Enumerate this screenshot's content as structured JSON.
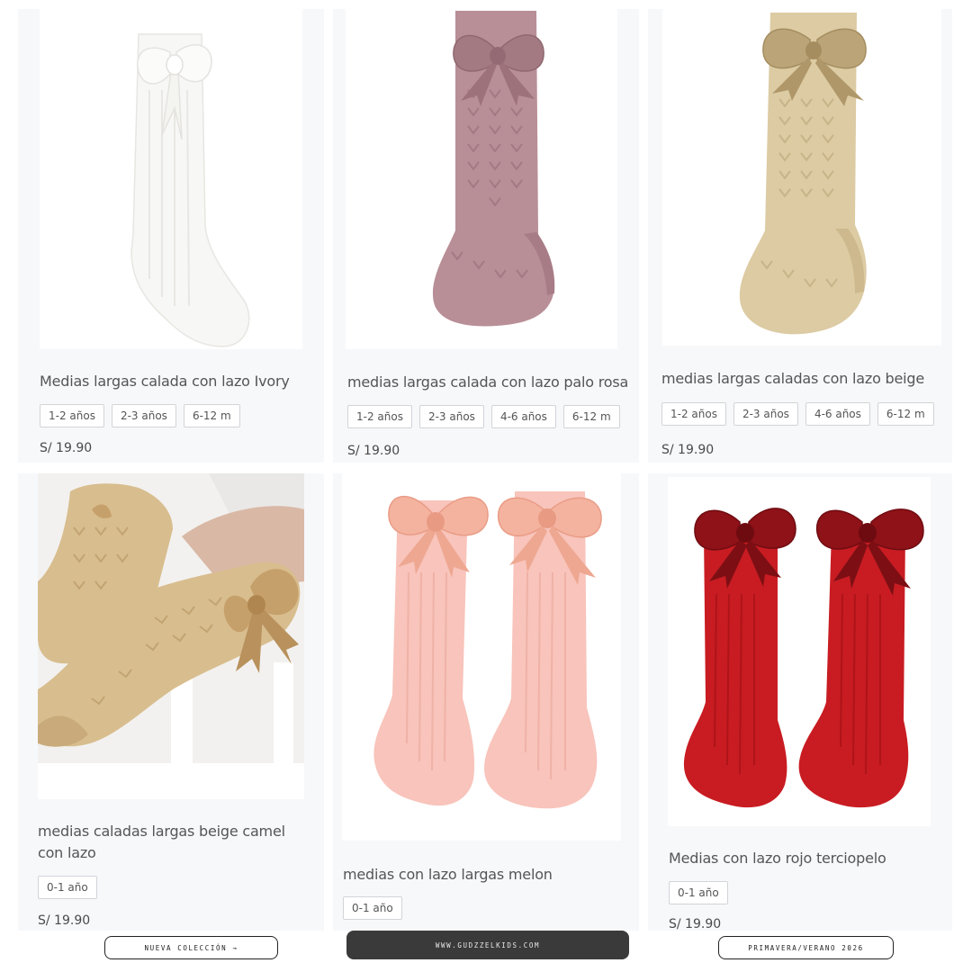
{
  "products": [
    {
      "title": "Medias largas calada con lazo Ivory",
      "sizes": [
        "1-2 años",
        "2-3 años",
        "6-12 m"
      ],
      "price": "S/ 19.90",
      "image": "ivory-knee-sock-with-bow"
    },
    {
      "title": "medias largas calada con lazo palo rosa",
      "sizes": [
        "1-2 años",
        "2-3 años",
        "4-6 años",
        "6-12 m"
      ],
      "price": "S/ 19.90",
      "image": "dusty-pink-knee-sock-with-bow"
    },
    {
      "title": "medias largas caladas con lazo beige",
      "sizes": [
        "1-2 años",
        "2-3 años",
        "4-6 años",
        "6-12 m"
      ],
      "price": "S/ 19.90",
      "image": "beige-knee-sock-with-bow"
    },
    {
      "title": "medias caladas largas beige camel con lazo",
      "sizes": [
        "0-1 año"
      ],
      "price": "S/ 19.90",
      "image": "camel-socks-on-baby-legs"
    },
    {
      "title": "medias con lazo largas melon",
      "sizes": [
        "0-1 año"
      ],
      "price": "",
      "image": "melon-socks-pair-with-bows"
    },
    {
      "title": "Medias con lazo rojo terciopelo",
      "sizes": [
        "0-1 año"
      ],
      "price": "S/ 19.90",
      "image": "red-socks-pair-velvet-bows"
    }
  ],
  "footer": {
    "left": "NUEVA COLECCIÓN →",
    "center": "WWW.GUDZZELKIDS.COM",
    "right": "PRIMAVERA/VERANO 2026"
  },
  "colors": {
    "ivory": "#f7f7f5",
    "palo_rosa": "#b88e97",
    "beige": "#dccba3",
    "camel": "#d8bd8e",
    "melon": "#f8c4bb",
    "rojo": "#c81c22",
    "velvet": "#8e1218"
  }
}
